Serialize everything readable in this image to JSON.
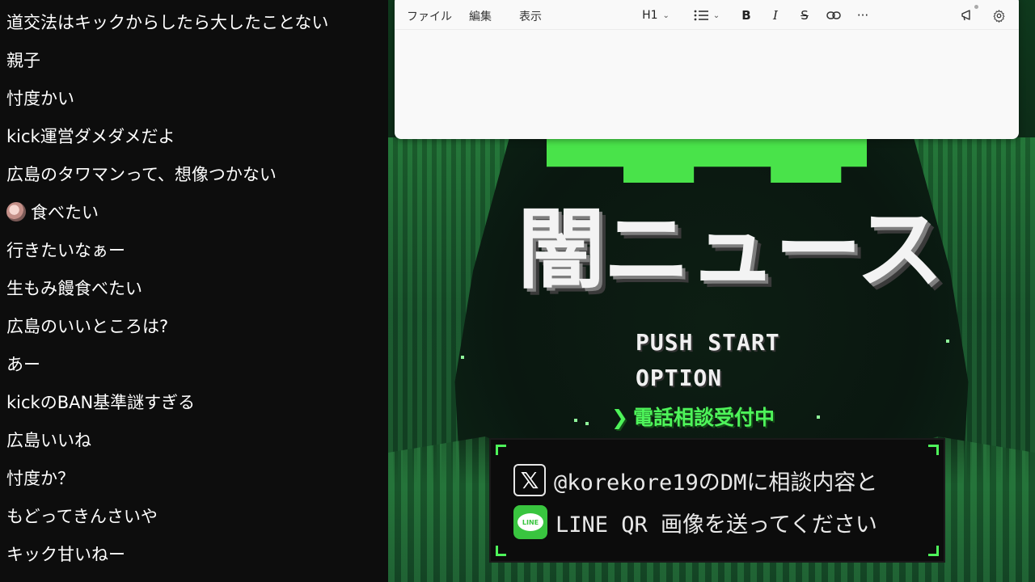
{
  "chat": {
    "messages": [
      {
        "text": "道交法はキックからしたら大したことない"
      },
      {
        "text": "親子"
      },
      {
        "text": "忖度かい"
      },
      {
        "text": "kick運営ダメダメだよ"
      },
      {
        "text": "広島のタワマンって、想像つかない"
      },
      {
        "text": "食べたい",
        "emoji": "oyster-emoji"
      },
      {
        "text": "行きたいなぁー"
      },
      {
        "text": "生もみ饅食べたい"
      },
      {
        "text": "広島のいいところは?"
      },
      {
        "text": "あー"
      },
      {
        "text": "kickのBAN基準謎すぎる"
      },
      {
        "text": "広島いいね"
      },
      {
        "text": "忖度か？"
      },
      {
        "text": "もどってきんさいや"
      },
      {
        "text": "キック甘いねー"
      }
    ]
  },
  "editor": {
    "menu": {
      "file": "ファイル",
      "edit": "編集",
      "view": "表示"
    },
    "heading": "H1",
    "bold": "B",
    "italic": "I",
    "strike": "S",
    "more": "···",
    "icons": [
      "list-icon",
      "link-icon",
      "megaphone-icon",
      "gear-icon"
    ]
  },
  "game": {
    "title": "闇ニュース",
    "menu": {
      "item1": "PUSH START",
      "item2": "OPTION",
      "selected_arrow": "❯",
      "selected": "電話相談受付中"
    },
    "info": {
      "x_icon": "𝕏",
      "line1": "@korekore19のDMに相談内容と",
      "line_icon_text": "LINE",
      "line2": "LINE QR 画像を送ってください"
    },
    "colors": {
      "accent": "#4ef45a",
      "cave": "#1d6a32"
    }
  }
}
